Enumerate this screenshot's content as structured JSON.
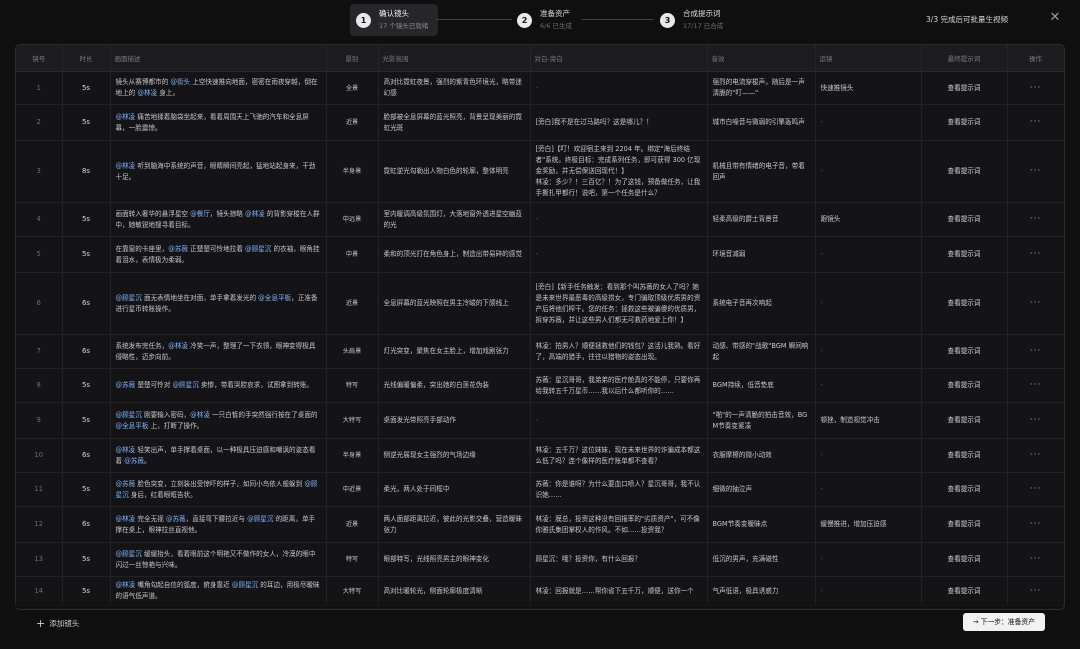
{
  "stepper": {
    "steps": [
      {
        "num": "1",
        "title": "确认镜头",
        "sub": "17 个镜头已就绪"
      },
      {
        "num": "2",
        "title": "准备资产",
        "sub": "6/6 已生成"
      },
      {
        "num": "3",
        "title": "合成提示词",
        "sub": "17/17 已合成"
      }
    ]
  },
  "header": {
    "status": "3/3 完成后可批量生视频",
    "close_label": "✕"
  },
  "table": {
    "columns": [
      "镜号",
      "时长",
      "画面描述",
      "景别",
      "光影氛围",
      "对白-旁白",
      "音效",
      "运镜",
      "最终提示词",
      "操作"
    ],
    "view_label": "查看提示词",
    "more_label": "···",
    "rows": [
      {
        "idx": "1",
        "dur": "5s",
        "desc": [
          {
            "t": "镜头从赛博都市的 "
          },
          {
            "t": "@街头",
            "m": true
          },
          {
            "t": " 上空快速推向地面，密密在雨夜穿越，倒在地上的 "
          },
          {
            "t": "@林凌",
            "m": true
          },
          {
            "t": " 身上。"
          }
        ],
        "shot": "全景",
        "light": "高对比霓虹夜景，强烈的紫青色环境光，略带迷幻感",
        "dialog": "-",
        "sound": "强烈的电流穿梭声，随后是一声清脆的\"叮——\"",
        "camera": "快速推镜头"
      },
      {
        "idx": "2",
        "dur": "5s",
        "desc": [
          {
            "t": "@林凌",
            "m": true
          },
          {
            "t": " 痛苦地揉着脑袋坐起来，看着周围天上飞驰的汽车和全息屏幕，一脸震惊。"
          }
        ],
        "shot": "近景",
        "light": "脸部被全息屏幕的蓝光照亮，背景呈现美丽的霓虹光斑",
        "dialog": "[旁白]我不是在过马路吗？这是哪儿？！",
        "sound": "城市白噪音与微弱的引擎轰鸣声",
        "camera": "-"
      },
      {
        "idx": "3",
        "dur": "8s",
        "desc": [
          {
            "t": "@林凌",
            "m": true
          },
          {
            "t": " 听到脑海中系统的声音，眼睛瞬间亮起，猛地站起身来，干劲十足。"
          }
        ],
        "shot": "半身景",
        "light": "霓虹逆光勾勒出人物白色的轮廓，整体明亮",
        "dialog": "[旁白]【叮！欢迎宿主来到 2204 年。绑定\"海后终结者\"系统。终极目标：完成系列任务，即可获得 300 亿现金奖励，并无偿保送回现代！】\n林凌：多少？！三百亿？！为了这钱，预备做任务，让我手撕扎甲都行！说吧，第一个任务是什么？",
        "sound": "机械且带有情绪的电子音，带着回声",
        "camera": "-"
      },
      {
        "idx": "4",
        "dur": "5s",
        "desc": [
          {
            "t": "画面转入奢华的悬浮星空 "
          },
          {
            "t": "@餐厅",
            "m": true
          },
          {
            "t": "，镜头掠略 "
          },
          {
            "t": "@林凌",
            "m": true
          },
          {
            "t": " 的背影穿梭在人群中，她敏锐地搜寻着目标。"
          }
        ],
        "shot": "中远景",
        "light": "室内暖调高级氛围灯，大落地窗外透进星空幽蓝的光",
        "dialog": "-",
        "sound": "轻柔高级的爵士背景音",
        "camera": "跟镜头"
      },
      {
        "idx": "5",
        "dur": "5s",
        "desc": [
          {
            "t": "在靠窗的卡座里，"
          },
          {
            "t": "@苏薇",
            "m": true
          },
          {
            "t": " 正楚楚可怜地拉着 "
          },
          {
            "t": "@顾星沉",
            "m": true
          },
          {
            "t": " 的衣袖，眼角挂着泪水，表情极为柔弱。"
          }
        ],
        "shot": "中景",
        "light": "柔和的顶光打在角色身上，制造出带易碎的感觉",
        "dialog": "-",
        "sound": "环境音减弱",
        "camera": "-"
      },
      {
        "idx": "6",
        "dur": "6s",
        "desc": [
          {
            "t": "@顾星沉",
            "m": true
          },
          {
            "t": " 面无表情地坐在对面，单手拿着发光的 "
          },
          {
            "t": "@全息平板",
            "m": true
          },
          {
            "t": "，正准备进行星币转账操作。"
          }
        ],
        "shot": "近景",
        "light": "全息屏幕的蓝光映照在男主冷峻的下颌线上",
        "dialog": "[旁白]【新手任务触发：看到那个叫苏薇的女人了吗？她是未来世界最恶毒的高级捞女，专门骗取顶级优质男的资产后将他们榨干。您的任务：拯救这些被骗傻的优质男，拆穿苏薇，并让这些男人们都无可救药地爱上你！】",
        "sound": "系统电子音再次响起",
        "camera": "-"
      },
      {
        "idx": "7",
        "dur": "6s",
        "desc": [
          {
            "t": "系统发布完任务，"
          },
          {
            "t": "@林凌",
            "m": true
          },
          {
            "t": " 冷笑一声，整理了一下衣领，眼神变得极具侵略性，迈步向前。"
          }
        ],
        "shot": "头肩景",
        "light": "灯光突变，聚焦在女主脸上，增加戏剧张力",
        "dialog": "林凌：拍男人？顺便拯救他们的钱包？这活儿我熟。看好了，高端的猎手，往往以猎物的姿态出现。",
        "sound": "动感、带感的\"战歌\"BGM 瞬间响起",
        "camera": "-"
      },
      {
        "idx": "8",
        "dur": "5s",
        "desc": [
          {
            "t": "@苏薇",
            "m": true
          },
          {
            "t": " 楚楚可怜对 "
          },
          {
            "t": "@顾星沉",
            "m": true
          },
          {
            "t": " 卖惨，带着哭腔哀求，试图拿到转账。"
          }
        ],
        "shot": "特写",
        "light": "光线偏暖偏柔，突出她的白莲花伪装",
        "dialog": "苏薇：星沉哥哥，我弟弟的医疗舱真的不能停，只要你再给我转五千万星币……我以后什么都听你的……",
        "sound": "BGM持续，低音垫底",
        "camera": "-"
      },
      {
        "idx": "9",
        "dur": "5s",
        "desc": [
          {
            "t": "@顾星沉",
            "m": true
          },
          {
            "t": " 刚要输入密码，"
          },
          {
            "t": "@林凌",
            "m": true
          },
          {
            "t": " 一只白皙的手突然强行按在了桌面的 "
          },
          {
            "t": "@全息平板",
            "m": true
          },
          {
            "t": " 上，打断了操作。"
          }
        ],
        "shot": "大特写",
        "light": "桌面发光带照亮手部动作",
        "dialog": "-",
        "sound": "\"啪\"的一声清脆的拍击音效，BGM节奏变紧凑",
        "camera": "顿挫，制造视觉冲击"
      },
      {
        "idx": "10",
        "dur": "6s",
        "desc": [
          {
            "t": "@林凌",
            "m": true
          },
          {
            "t": " 轻笑出声，单手撑着桌面，以一种极具压迫感和嘲讽的姿态看着 "
          },
          {
            "t": "@苏薇",
            "m": true
          },
          {
            "t": "。"
          }
        ],
        "shot": "半身景",
        "light": "侧逆光展现女主强烈的气场边缘",
        "dialog": "林凌：五千万？这位妹妹，现在未来世界的诈骗成本都这么低了吗？连个像样的医疗账单都不查看？",
        "sound": "衣服摩擦的微小动效",
        "camera": "-"
      },
      {
        "idx": "11",
        "dur": "5s",
        "desc": [
          {
            "t": "@苏薇",
            "m": true
          },
          {
            "t": " 脸色突变，立刻装出受惊吓的样子，如同小鸟依人般躲到 "
          },
          {
            "t": "@顾星沉",
            "m": true
          },
          {
            "t": " 身后，红着眼眶告状。"
          }
        ],
        "shot": "中近景",
        "light": "柔光，两人处于同框中",
        "dialog": "苏薇：你是谁呀？为什么要血口喷人？星沉哥哥，我不认识她……",
        "sound": "细微的抽泣声",
        "camera": "-"
      },
      {
        "idx": "12",
        "dur": "6s",
        "desc": [
          {
            "t": "@林凌",
            "m": true
          },
          {
            "t": " 完全无视 "
          },
          {
            "t": "@苏薇",
            "m": true
          },
          {
            "t": "，直接弯下腰拉近与 "
          },
          {
            "t": "@顾星沉",
            "m": true
          },
          {
            "t": " 的距离，单手撑在桌上，眼神拉丝直视他。"
          }
        ],
        "shot": "近景",
        "light": "两人面部距离拉近，彼此的光影交叠，营造暧昧张力",
        "dialog": "林凌：膜总，投资这种没有回报率的\"劣质资产\"，可不像你雅氏集团掌权人的作风。不如……投资我？",
        "sound": "BGM节奏变暧昧点",
        "camera": "缓慢推进，增加压迫感"
      },
      {
        "idx": "13",
        "dur": "5s",
        "desc": [
          {
            "t": "@顾星沉",
            "m": true
          },
          {
            "t": " 缓缓抬头，看着眼前这个明艳又不做作的女人，冷漠的眼中闪过一丝惊艳与兴味。"
          }
        ],
        "shot": "特写",
        "light": "眼部特写，光线照亮男主的眼神变化",
        "dialog": "顾星沉：哦？投资你，有什么回报？",
        "sound": "低沉的男声，充满磁性",
        "camera": "-"
      },
      {
        "idx": "14",
        "dur": "5s",
        "desc": [
          {
            "t": "@林凌",
            "m": true
          },
          {
            "t": " 嘴角勾起自信的弧度，俯身靠近 "
          },
          {
            "t": "@顾星沉",
            "m": true
          },
          {
            "t": " 的耳边，用极尽暧昧的语气低声道。"
          }
        ],
        "shot": "大特写",
        "light": "高对比暖轮光，侧面轮廓极度清晰",
        "dialog": "林凌：回报就是……帮你省下五千万，顺便，送你一个",
        "sound": "气声低语，极具诱惑力",
        "camera": "-"
      }
    ]
  },
  "footer": {
    "add_label": "添加镜头",
    "next_label": "→ 下一步：准备资产"
  },
  "colors": {
    "mention": "#7fb3ff",
    "background": "#0f0f10"
  }
}
